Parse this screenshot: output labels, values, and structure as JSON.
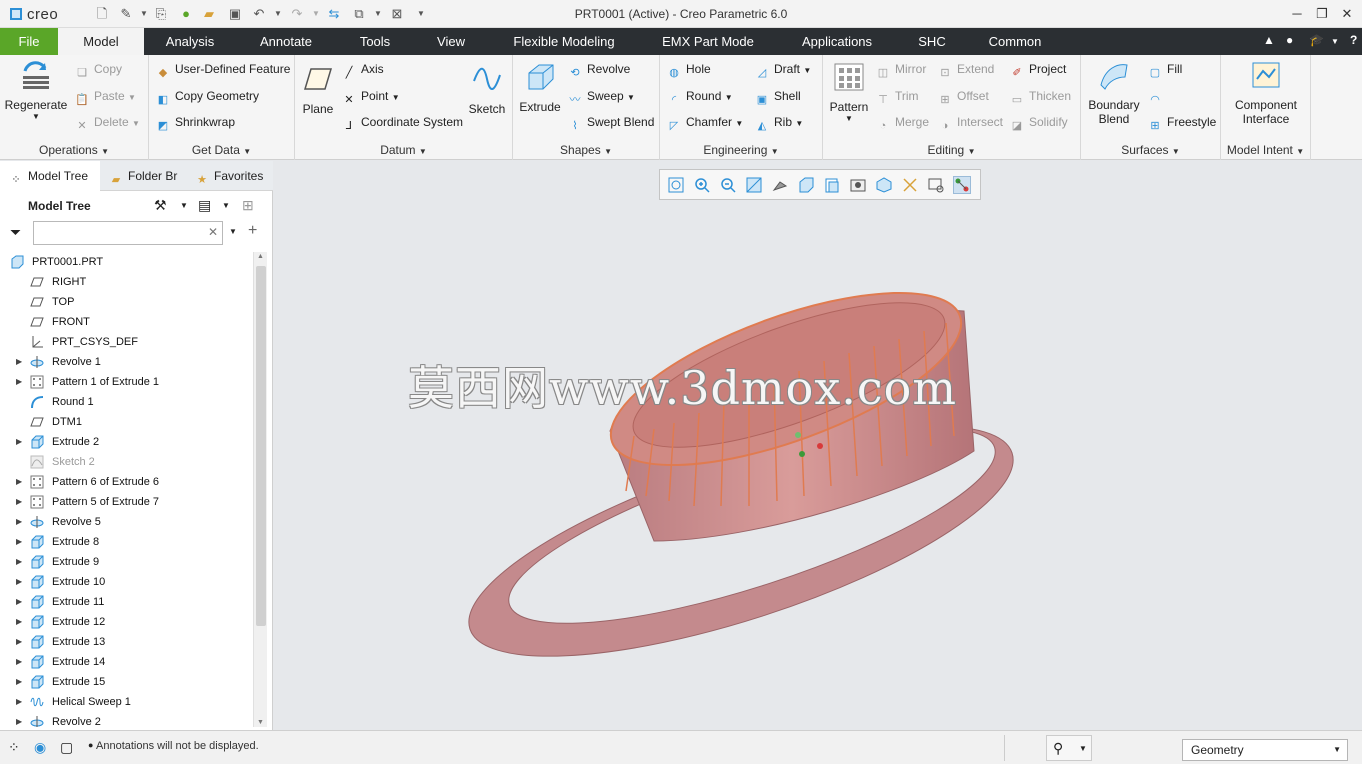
{
  "app": {
    "logo": "creo",
    "window_title": "PRT0001 (Active) - Creo Parametric 6.0"
  },
  "tabs": [
    {
      "label": "File"
    },
    {
      "label": "Model"
    },
    {
      "label": "Analysis"
    },
    {
      "label": "Annotate"
    },
    {
      "label": "Tools"
    },
    {
      "label": "View"
    },
    {
      "label": "Flexible Modeling"
    },
    {
      "label": "EMX Part Mode"
    },
    {
      "label": "Applications"
    },
    {
      "label": "SHC"
    },
    {
      "label": "Common"
    }
  ],
  "ribbon": {
    "operations": {
      "label": "Operations",
      "regenerate": "Regenerate",
      "copy": "Copy",
      "paste": "Paste",
      "delete": "Delete"
    },
    "getdata": {
      "label": "Get Data",
      "udf": "User-Defined Feature",
      "copy_geometry": "Copy Geometry",
      "shrinkwrap": "Shrinkwrap"
    },
    "datum": {
      "label": "Datum",
      "plane": "Plane",
      "axis": "Axis",
      "point": "Point",
      "csys": "Coordinate System",
      "sketch": "Sketch"
    },
    "shapes": {
      "label": "Shapes",
      "extrude": "Extrude",
      "revolve": "Revolve",
      "sweep": "Sweep",
      "swept_blend": "Swept Blend"
    },
    "engineering": {
      "label": "Engineering",
      "hole": "Hole",
      "round": "Round",
      "chamfer": "Chamfer",
      "draft": "Draft",
      "shell": "Shell",
      "rib": "Rib"
    },
    "editing": {
      "label": "Editing",
      "pattern": "Pattern",
      "mirror": "Mirror",
      "trim": "Trim",
      "merge": "Merge",
      "extend": "Extend",
      "offset": "Offset",
      "intersect": "Intersect",
      "project": "Project",
      "thicken": "Thicken",
      "solidify": "Solidify"
    },
    "surfaces": {
      "label": "Surfaces",
      "boundary_blend_1": "Boundary",
      "boundary_blend_2": "Blend",
      "fill": "Fill",
      "freestyle": "Freestyle"
    },
    "modelintent": {
      "label": "Model Intent",
      "component_interface_1": "Component",
      "component_interface_2": "Interface"
    }
  },
  "panel": {
    "tabs": [
      "Model Tree",
      "Folder Br",
      "Favorites"
    ],
    "header": "Model Tree",
    "search_value": ""
  },
  "tree": [
    {
      "label": "PRT0001.PRT",
      "icon": "part-icon",
      "level": 0,
      "expandable": false,
      "dim": false
    },
    {
      "label": "RIGHT",
      "icon": "datum-plane-icon",
      "level": 1,
      "expandable": false,
      "dim": false
    },
    {
      "label": "TOP",
      "icon": "datum-plane-icon",
      "level": 1,
      "expandable": false,
      "dim": false
    },
    {
      "label": "FRONT",
      "icon": "datum-plane-icon",
      "level": 1,
      "expandable": false,
      "dim": false
    },
    {
      "label": "PRT_CSYS_DEF",
      "icon": "csys-icon",
      "level": 1,
      "expandable": false,
      "dim": false
    },
    {
      "label": "Revolve 1",
      "icon": "revolve-icon",
      "level": 1,
      "expandable": true,
      "dim": false
    },
    {
      "label": "Pattern 1 of Extrude 1",
      "icon": "pattern-icon",
      "level": 1,
      "expandable": true,
      "dim": false
    },
    {
      "label": "Round 1",
      "icon": "round-icon",
      "level": 1,
      "expandable": false,
      "dim": false
    },
    {
      "label": "DTM1",
      "icon": "datum-plane-icon",
      "level": 1,
      "expandable": false,
      "dim": false
    },
    {
      "label": "Extrude 2",
      "icon": "extrude-icon",
      "level": 1,
      "expandable": true,
      "dim": false
    },
    {
      "label": "Sketch 2",
      "icon": "sketch-icon",
      "level": 1,
      "expandable": false,
      "dim": true
    },
    {
      "label": "Pattern 6 of Extrude 6",
      "icon": "pattern-icon",
      "level": 1,
      "expandable": true,
      "dim": false
    },
    {
      "label": "Pattern 5 of Extrude 7",
      "icon": "pattern-icon",
      "level": 1,
      "expandable": true,
      "dim": false
    },
    {
      "label": "Revolve 5",
      "icon": "revolve-icon",
      "level": 1,
      "expandable": true,
      "dim": false
    },
    {
      "label": "Extrude 8",
      "icon": "extrude-icon",
      "level": 1,
      "expandable": true,
      "dim": false
    },
    {
      "label": "Extrude 9",
      "icon": "extrude-icon",
      "level": 1,
      "expandable": true,
      "dim": false
    },
    {
      "label": "Extrude 10",
      "icon": "extrude-icon",
      "level": 1,
      "expandable": true,
      "dim": false
    },
    {
      "label": "Extrude 11",
      "icon": "extrude-icon",
      "level": 1,
      "expandable": true,
      "dim": false
    },
    {
      "label": "Extrude 12",
      "icon": "extrude-icon",
      "level": 1,
      "expandable": true,
      "dim": false
    },
    {
      "label": "Extrude 13",
      "icon": "extrude-icon",
      "level": 1,
      "expandable": true,
      "dim": false
    },
    {
      "label": "Extrude 14",
      "icon": "extrude-icon",
      "level": 1,
      "expandable": true,
      "dim": false
    },
    {
      "label": "Extrude 15",
      "icon": "extrude-icon",
      "level": 1,
      "expandable": true,
      "dim": false
    },
    {
      "label": "Helical Sweep 1",
      "icon": "helical-sweep-icon",
      "level": 1,
      "expandable": true,
      "dim": false
    },
    {
      "label": "Revolve 2",
      "icon": "revolve-icon",
      "level": 1,
      "expandable": true,
      "dim": false
    }
  ],
  "viewport": {
    "watermark": "莫西网www.3dmox.com",
    "model_color": "#c98d8f",
    "highlight_color": "#e07b50"
  },
  "status": {
    "message": "Annotations will not be displayed.",
    "filter_value": "Geometry"
  },
  "colors": {
    "file_tab": "#5aa628",
    "tab_bar": "#2b2f33",
    "accent_blue": "#2c8fd6"
  }
}
